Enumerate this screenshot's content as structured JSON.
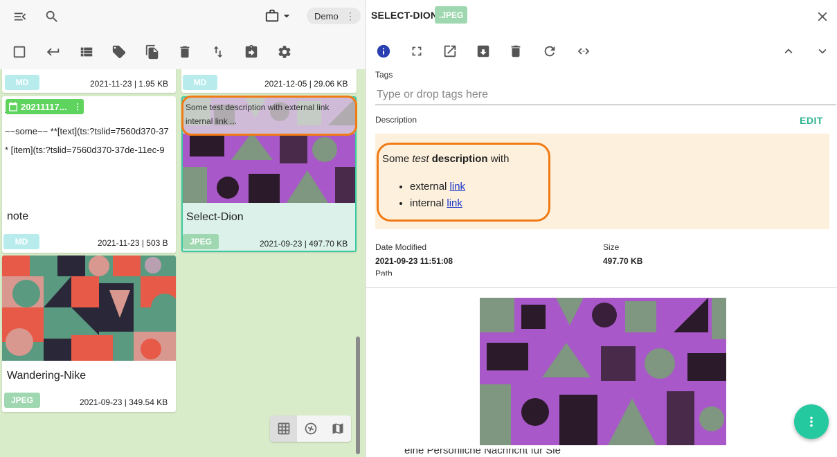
{
  "toolbar": {
    "location_label": "Demo",
    "icons": [
      "menu-open-icon",
      "search-icon",
      "briefcase-icon",
      "dropdown-arrow-icon",
      "more-vert-icon",
      "checkbox-icon",
      "return-icon",
      "list-icon",
      "tag-icon",
      "copy-icon",
      "delete-icon",
      "sort-icon",
      "export-icon",
      "settings-icon"
    ]
  },
  "cards": {
    "md1": {
      "badge": "MD",
      "meta": "2021-11-23 | 1.95 KB"
    },
    "md2": {
      "badge": "MD",
      "meta": "2021-12-05 | 29.06 KB"
    },
    "note": {
      "date_chip": "20211117...",
      "line1": "~~some~~ **[text](ts:?tslid=7560d370-37",
      "line2": "*   [item](ts:?tslid=7560d370-37de-11ec-9",
      "title": "note",
      "badge": "MD",
      "meta": "2021-11-23 | 503 B"
    },
    "select_dion": {
      "desc_overlay": "Some test description with external link internal link ...",
      "title": "Select-Dion",
      "badge": "JPEG",
      "meta": "2021-09-23 | 497.70 KB"
    },
    "wandering_nike": {
      "title": "Wandering-Nike",
      "badge": "JPEG",
      "meta": "2021-09-23 | 349.54 KB"
    }
  },
  "colors": {
    "md_badge": "#b8ecec",
    "jpeg_badge": "#9fd8b0",
    "accent": "#24c9a0",
    "highlight": "#f07a14",
    "panel_bg": "#d9ecca"
  },
  "details": {
    "file_name": "SELECT-DION",
    "extension": ".JPEG",
    "tags_label": "Tags",
    "tags_placeholder": "Type or drop tags here",
    "description_label": "Description",
    "edit_label": "EDIT",
    "description": {
      "prefix": "Some ",
      "italic": "test",
      "bold": "description",
      "suffix": " with",
      "items": [
        {
          "text": "external ",
          "link": "link"
        },
        {
          "text": "internal ",
          "link": "link"
        }
      ]
    },
    "date_modified_label": "Date Modified",
    "date_modified": "2021-09-23 11:51:08",
    "size_label": "Size",
    "size": "497.70 KB",
    "path_label": "Path",
    "bottom_text": "eine Persönliche Nachricht für Sie"
  }
}
